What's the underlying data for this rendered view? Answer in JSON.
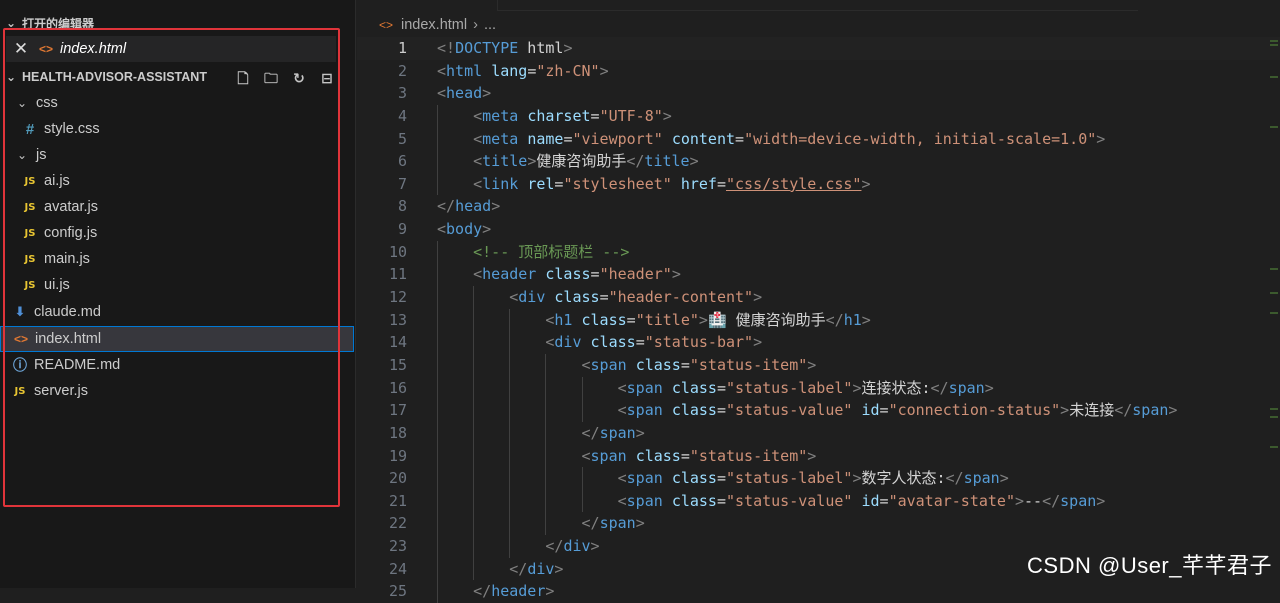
{
  "sidebar": {
    "open_editors_title": "打开的编辑器",
    "open_editors": [
      {
        "name": "index.html",
        "icon": "html-file-icon"
      }
    ],
    "folder_title": "HEALTH-ADVISOR-ASSISTANT",
    "folder_actions": [
      "new-file-icon",
      "new-folder-icon",
      "refresh-icon",
      "collapse-all-icon"
    ],
    "tree": [
      {
        "type": "folder",
        "name": "css",
        "icon": "chevron-down-icon"
      },
      {
        "type": "file",
        "name": "style.css",
        "icon": "css-file-icon"
      },
      {
        "type": "folder",
        "name": "js",
        "icon": "chevron-down-icon"
      },
      {
        "type": "file",
        "name": "ai.js",
        "icon": "js-file-icon"
      },
      {
        "type": "file",
        "name": "avatar.js",
        "icon": "js-file-icon"
      },
      {
        "type": "file",
        "name": "config.js",
        "icon": "js-file-icon"
      },
      {
        "type": "file",
        "name": "main.js",
        "icon": "js-file-icon"
      },
      {
        "type": "file",
        "name": "ui.js",
        "icon": "js-file-icon"
      },
      {
        "type": "file",
        "name": "claude.md",
        "icon": "markdown-download-icon"
      },
      {
        "type": "file",
        "name": "index.html",
        "icon": "html-file-icon",
        "selected": true
      },
      {
        "type": "file",
        "name": "README.md",
        "icon": "info-icon"
      },
      {
        "type": "file",
        "name": "server.js",
        "icon": "js-file-icon"
      }
    ]
  },
  "editor": {
    "breadcrumb_file": "index.html",
    "breadcrumb_more": "...",
    "lines": [
      {
        "n": "1",
        "text": "<!DOCTYPE html>"
      },
      {
        "n": "2",
        "text": "<html lang=\"zh-CN\">"
      },
      {
        "n": "3",
        "text": "<head>"
      },
      {
        "n": "4",
        "text": "    <meta charset=\"UTF-8\">"
      },
      {
        "n": "5",
        "text": "    <meta name=\"viewport\" content=\"width=device-width, initial-scale=1.0\">"
      },
      {
        "n": "6",
        "text": "    <title>健康咨询助手</title>"
      },
      {
        "n": "7",
        "text": "    <link rel=\"stylesheet\" href=\"css/style.css\">"
      },
      {
        "n": "8",
        "text": "</head>"
      },
      {
        "n": "9",
        "text": "<body>"
      },
      {
        "n": "10",
        "text": "    <!-- 顶部标题栏 -->"
      },
      {
        "n": "11",
        "text": "    <header class=\"header\">"
      },
      {
        "n": "12",
        "text": "        <div class=\"header-content\">"
      },
      {
        "n": "13",
        "text": "            <h1 class=\"title\">🏥 健康咨询助手</h1>"
      },
      {
        "n": "14",
        "text": "            <div class=\"status-bar\">"
      },
      {
        "n": "15",
        "text": "                <span class=\"status-item\">"
      },
      {
        "n": "16",
        "text": "                    <span class=\"status-label\">连接状态:</span>"
      },
      {
        "n": "17",
        "text": "                    <span class=\"status-value\" id=\"connection-status\">未连接</span>"
      },
      {
        "n": "18",
        "text": "                </span>"
      },
      {
        "n": "19",
        "text": "                <span class=\"status-item\">"
      },
      {
        "n": "20",
        "text": "                    <span class=\"status-label\">数字人状态:</span>"
      },
      {
        "n": "21",
        "text": "                    <span class=\"status-value\" id=\"avatar-state\">--</span>"
      },
      {
        "n": "22",
        "text": "                </span>"
      },
      {
        "n": "23",
        "text": "            </div>"
      },
      {
        "n": "24",
        "text": "        </div>"
      },
      {
        "n": "25",
        "text": "    </header>"
      }
    ]
  },
  "watermark": "CSDN @User_芊芊君子",
  "colors": {
    "accent": "#0078d4",
    "highlight_box": "#e0343a",
    "js_icon": "#e8c532",
    "html_icon": "#e37933"
  }
}
